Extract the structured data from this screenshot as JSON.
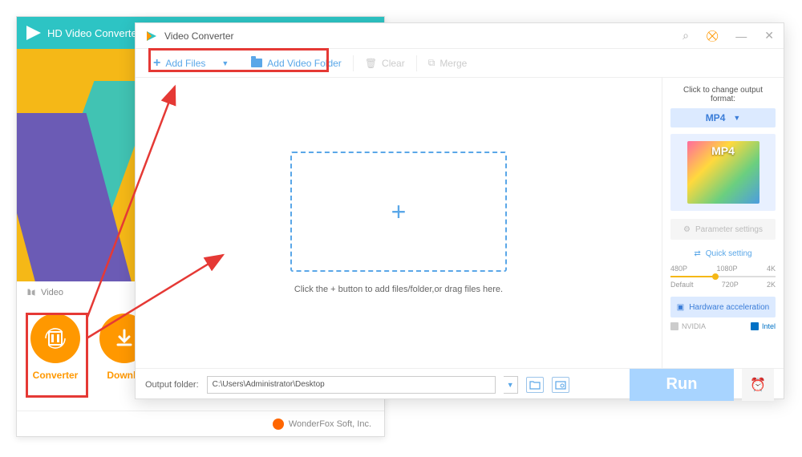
{
  "bg_window": {
    "title": "HD Video Converter F",
    "section_label": "Video",
    "tabs": {
      "converter": "Converter",
      "downloader": "Downlo"
    },
    "footer": "WonderFox Soft, Inc."
  },
  "fg_window": {
    "title": "Video Converter",
    "toolbar": {
      "add_files": "Add Files",
      "add_folder": "Add Video Folder",
      "clear": "Clear",
      "merge": "Merge"
    },
    "drop_hint": "Click the + button to add files/folder,or drag files here.",
    "side": {
      "click_label": "Click to change output format:",
      "format": "MP4",
      "thumb_label": "MP4",
      "param": "Parameter settings",
      "quick_setting": "Quick setting",
      "qs_top": {
        "a": "480P",
        "b": "1080P",
        "c": "4K"
      },
      "qs_bot": {
        "a": "Default",
        "b": "720P",
        "c": "2K"
      },
      "hw": "Hardware acceleration",
      "nvidia": "NVIDIA",
      "intel": "Intel"
    },
    "bottom": {
      "label": "Output folder:",
      "path": "C:\\Users\\Administrator\\Desktop",
      "run": "Run"
    }
  }
}
